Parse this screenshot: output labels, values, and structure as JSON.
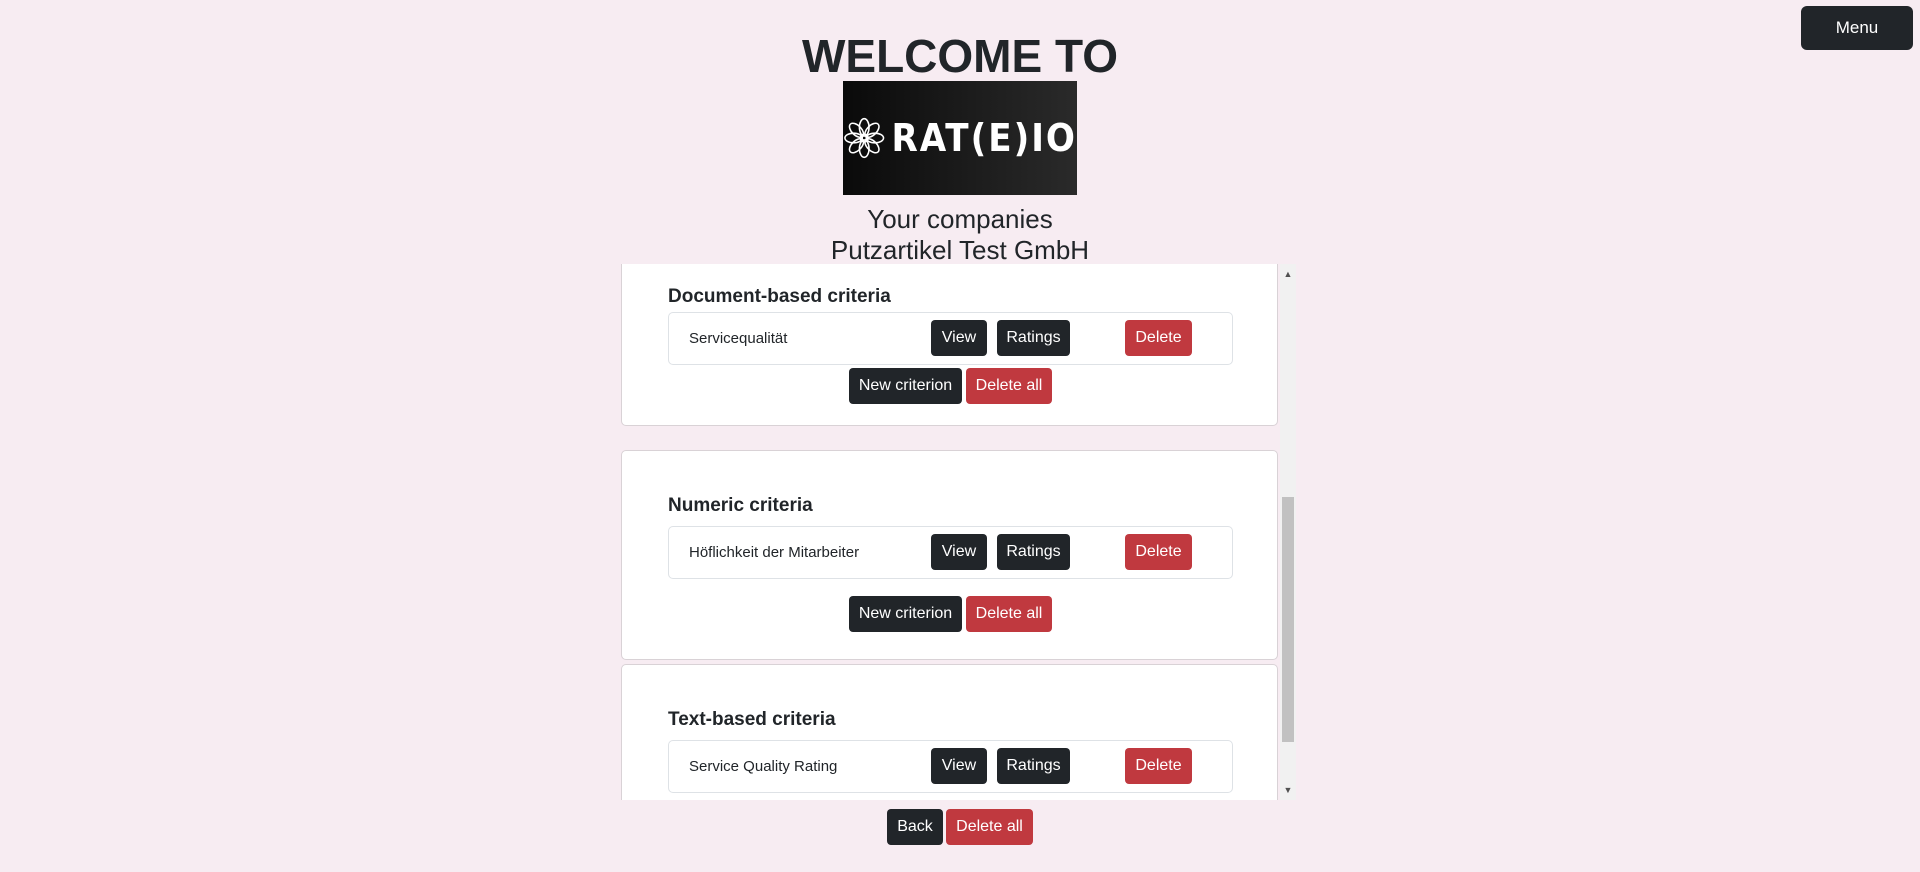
{
  "menu": {
    "label": "Menu"
  },
  "header": {
    "welcome": "WELCOME TO",
    "logo_text": "RAT(E)IO",
    "subtitle": "Your companies",
    "company": "Putzartikel Test GmbH"
  },
  "sections": [
    {
      "title": "Document-based criteria",
      "criteria": [
        {
          "name": "Servicequalität"
        }
      ]
    },
    {
      "title": "Numeric criteria",
      "criteria": [
        {
          "name": "Höflichkeit der Mitarbeiter"
        }
      ]
    },
    {
      "title": "Text-based criteria",
      "criteria": [
        {
          "name": "Service Quality Rating"
        }
      ]
    }
  ],
  "row_actions": {
    "view": "View",
    "ratings": "Ratings",
    "delete": "Delete"
  },
  "section_actions": {
    "new": "New criterion",
    "delete_all": "Delete all"
  },
  "footer": {
    "back": "Back",
    "delete_all": "Delete all"
  },
  "colors": {
    "background": "#f7ecf2",
    "dark": "#212529",
    "danger": "#c0393f"
  }
}
